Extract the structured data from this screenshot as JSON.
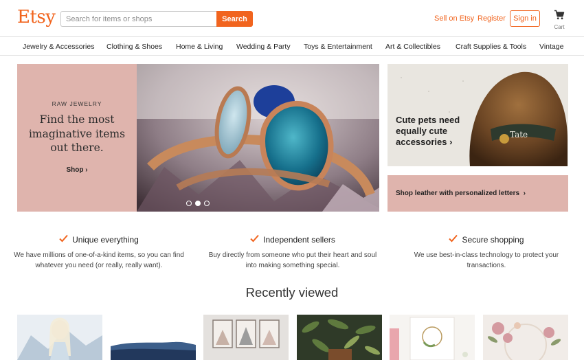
{
  "header": {
    "logo": "Etsy",
    "search_placeholder": "Search for items or shops",
    "search_button": "Search",
    "sell_link": "Sell on Etsy",
    "register_link": "Register",
    "signin_button": "Sign in",
    "cart_label": "Cart"
  },
  "categories": [
    "Jewelry & Accessories",
    "Clothing & Shoes",
    "Home & Living",
    "Wedding & Party",
    "Toys & Entertainment",
    "Art & Collectibles",
    "Craft Supplies & Tools",
    "Vintage"
  ],
  "hero": {
    "kicker": "RAW JEWELRY",
    "title": "Find the most imaginative items out there.",
    "cta": "Shop",
    "carousel_active": 2
  },
  "side_cards": {
    "pets_text": "Cute pets need equally cute accessories",
    "pets_tag": "Tate",
    "leather_text": "Shop leather with personalized letters"
  },
  "value_props": [
    {
      "title": "Unique everything",
      "desc": "We have millions of one-of-a-kind items, so you can find whatever you need (or really, really want)."
    },
    {
      "title": "Independent sellers",
      "desc": "Buy directly from someone who put their heart and soul into making something special."
    },
    {
      "title": "Secure shopping",
      "desc": "We use best-in-class technology to protect your transactions."
    }
  ],
  "recently_viewed": {
    "title": "Recently viewed"
  },
  "colors": {
    "brand": "#f1641e",
    "pink_panel": "#dfb4ad"
  }
}
